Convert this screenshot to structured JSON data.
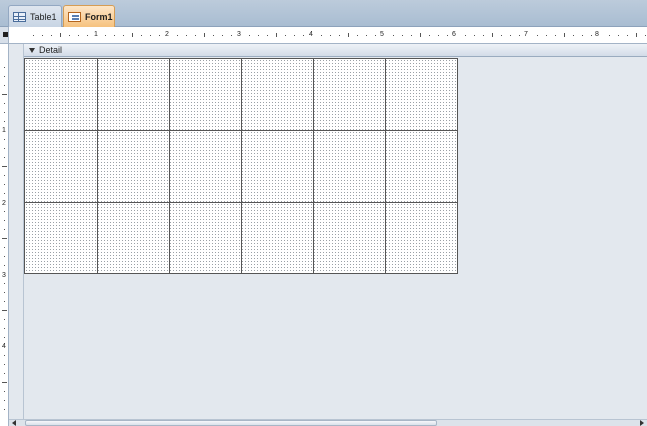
{
  "tabs": [
    {
      "label": "Table1",
      "icon": "table-icon",
      "active": false
    },
    {
      "label": "Form1",
      "icon": "form-icon",
      "active": true
    }
  ],
  "section": {
    "label": "Detail",
    "icon": "section-caret-icon"
  },
  "ruler": {
    "horizontal_numbers": [
      "1",
      "2",
      "3",
      "4",
      "5",
      "6",
      "7",
      "8"
    ],
    "vertical_numbers": [
      "1",
      "2",
      "3",
      "4"
    ]
  },
  "grid": {
    "columns": 6,
    "rows": 3,
    "background": "#ffffff",
    "line_color": "#555555"
  },
  "colors": {
    "active_tab": "#f6c27e",
    "inactive_tab": "#c8d5e4",
    "workspace": "#e3e8ee"
  }
}
